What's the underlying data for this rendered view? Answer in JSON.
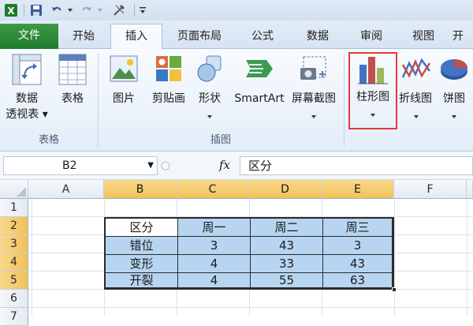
{
  "ribbon_tabs": [
    "文件",
    "开始",
    "插入",
    "页面布局",
    "公式",
    "数据",
    "审阅",
    "视图",
    "开"
  ],
  "ribbon": {
    "pivot_table": {
      "line1": "数据",
      "line2": "透视表"
    },
    "table": "表格",
    "picture": "图片",
    "clipart": "剪贴画",
    "shapes": "形状",
    "smartart": "SmartArt",
    "screenshot": "屏幕截图",
    "column_chart": "柱形图",
    "line_chart": "折线图",
    "pie_chart": "饼图",
    "group_tables": "表格",
    "group_illustrations": "插图"
  },
  "formula_bar": {
    "name_box": "B2",
    "fx": "fx",
    "content": "区分"
  },
  "grid": {
    "columns": [
      "A",
      "B",
      "C",
      "D",
      "E",
      "F"
    ],
    "rows": [
      "1",
      "2",
      "3",
      "4",
      "5",
      "6",
      "7"
    ],
    "table": {
      "headers": [
        "区分",
        "周一",
        "周二",
        "周三"
      ],
      "rows": [
        [
          "错位",
          "3",
          "43",
          "3"
        ],
        [
          "变形",
          "4",
          "33",
          "43"
        ],
        [
          "开裂",
          "4",
          "55",
          "63"
        ]
      ]
    }
  },
  "colors": {
    "file_tab": "#2e8b3a",
    "highlight_box": "#e0393e",
    "selected_header": "#f4c866",
    "table_fill": "#b7d5f1"
  }
}
